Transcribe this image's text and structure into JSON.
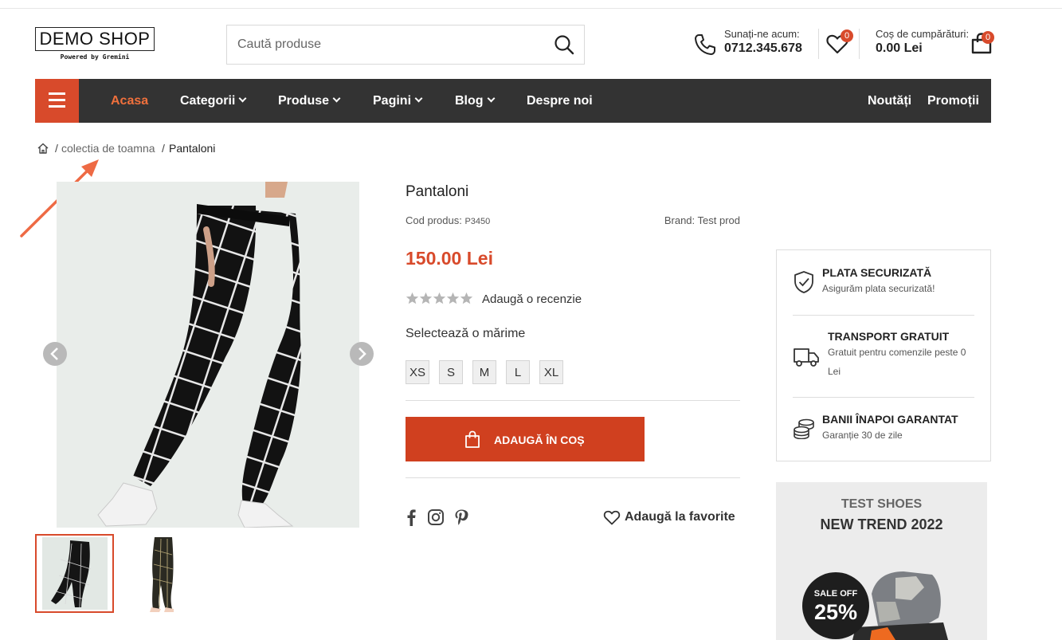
{
  "header": {
    "logo": {
      "main": "DEMO SHOP",
      "sub": "Powered by Gremini"
    },
    "search": {
      "placeholder": "Caută produse"
    },
    "phone": {
      "label": "Sunați-ne acum:",
      "number": "0712.345.678"
    },
    "wishlist": {
      "count": "0"
    },
    "cart": {
      "label": "Coș de cumpărături:",
      "total": "0.00 Lei",
      "count": "0"
    }
  },
  "nav": {
    "items": [
      {
        "label": "Acasa",
        "active": true
      },
      {
        "label": "Categorii"
      },
      {
        "label": "Produse"
      },
      {
        "label": "Pagini"
      },
      {
        "label": "Blog"
      },
      {
        "label": "Despre noi"
      }
    ],
    "right": [
      {
        "label": "Noutăți"
      },
      {
        "label": "Promoții"
      }
    ],
    "accent_color": "#d84a2b"
  },
  "breadcrumb": {
    "items": [
      {
        "label": "colectia de toamna"
      },
      {
        "label": "Pantaloni"
      }
    ]
  },
  "product": {
    "title": "Pantaloni",
    "code_label": "Cod produs:",
    "code_value": "P3450",
    "brand": "Brand: Test prod",
    "price": "150.00 Lei",
    "rating": 0,
    "review_link": "Adaugă o recenzie",
    "size_label": "Selectează o mărime",
    "sizes": [
      "XS",
      "S",
      "M",
      "L",
      "XL"
    ],
    "add_to_cart": "ADAUGĂ ÎN COȘ",
    "favorite": "Adaugă la favorite",
    "social": [
      "facebook-icon",
      "instagram-icon",
      "pinterest-icon"
    ]
  },
  "benefits": [
    {
      "title": "PLATA SECURIZATĂ",
      "desc": "Asigurăm plata securizată!",
      "icon": "shield-check-icon"
    },
    {
      "title": "TRANSPORT GRATUIT",
      "desc": "Gratuit pentru comenzile peste 0 Lei",
      "icon": "truck-icon"
    },
    {
      "title": "BANII ÎNAPOI GARANTAT",
      "desc": "Garanție 30 de zile",
      "icon": "coins-icon"
    }
  ],
  "banner": {
    "title": "TEST SHOES",
    "subtitle": "NEW TREND 2022",
    "sale_label": "SALE OFF",
    "sale_value": "25%"
  }
}
